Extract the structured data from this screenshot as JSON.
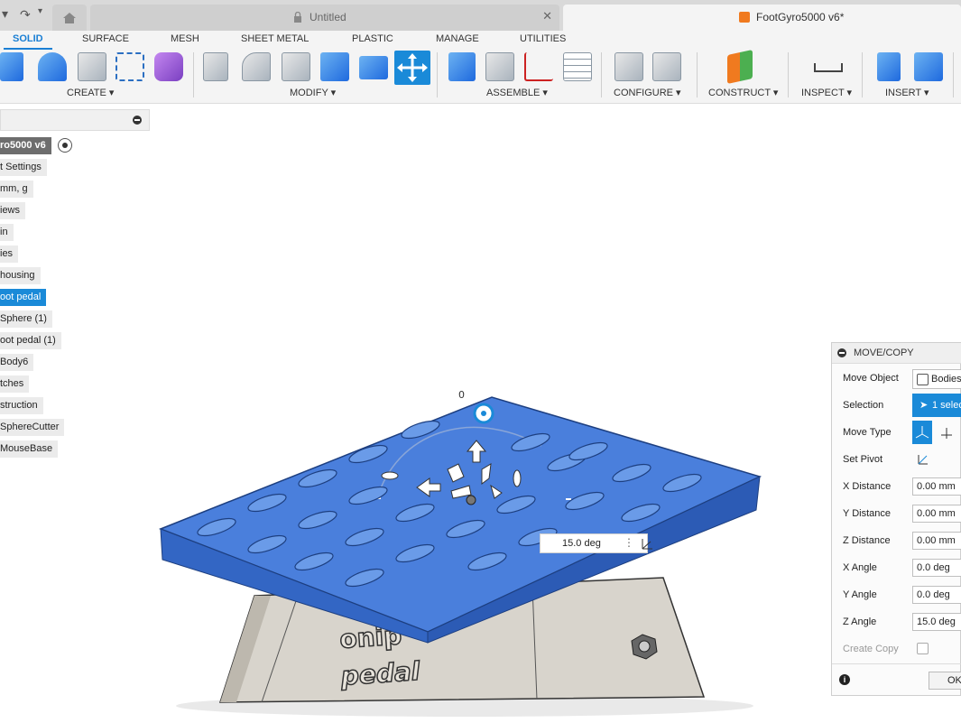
{
  "titlebar": {
    "untitled_tab": "Untitled",
    "active_tab": "FootGyro5000 v6*",
    "close_glyph": "✕",
    "lock_glyph": "🔒",
    "back_glyph": "▾",
    "redo_glyph": "↷"
  },
  "ribbon": {
    "tabs": [
      "SOLID",
      "SURFACE",
      "MESH",
      "SHEET METAL",
      "PLASTIC",
      "MANAGE",
      "UTILITIES"
    ],
    "groups": [
      "CREATE ▾",
      "MODIFY ▾",
      "ASSEMBLE ▾",
      "CONFIGURE ▾",
      "CONSTRUCT ▾",
      "INSPECT ▾",
      "INSERT ▾"
    ]
  },
  "browser": {
    "nodes": [
      "ro5000 v6",
      "t Settings",
      " mm, g",
      "iews",
      "in",
      "ies",
      "housing",
      "oot pedal",
      "Sphere (1)",
      "oot pedal (1)",
      "Body6",
      "tches",
      "struction",
      "SphereCutter",
      "MouseBase"
    ]
  },
  "viewport": {
    "angle_value": "15.0 deg",
    "base_text_1": "onip",
    "base_text_2": "pedal",
    "manip_label": "0"
  },
  "dialog": {
    "title": "MOVE/COPY",
    "move_object_label": "Move Object",
    "move_object_value": "Bodies",
    "selection_label": "Selection",
    "selection_value": "1 selec",
    "move_type_label": "Move Type",
    "set_pivot_label": "Set Pivot",
    "x_distance_label": "X Distance",
    "x_distance_value": "0.00 mm",
    "y_distance_label": "Y Distance",
    "y_distance_value": "0.00 mm",
    "z_distance_label": "Z Distance",
    "z_distance_value": "0.00 mm",
    "x_angle_label": "X Angle",
    "x_angle_value": "0.0 deg",
    "y_angle_label": "Y Angle",
    "y_angle_value": "0.0 deg",
    "z_angle_label": "Z Angle",
    "z_angle_value": "15.0 deg",
    "create_copy_label": "Create Copy",
    "ok_label": "OK"
  }
}
